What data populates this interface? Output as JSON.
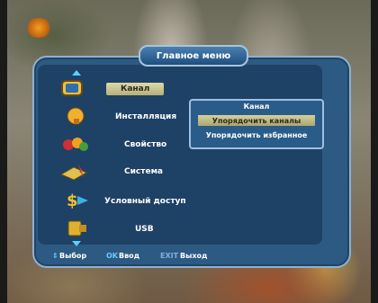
{
  "main_menu": {
    "title": "Главное меню",
    "items": [
      {
        "label": "Канал",
        "icon": "tv-icon",
        "selected": true
      },
      {
        "label": "Инсталляция",
        "icon": "satellite-dish-icon",
        "selected": false
      },
      {
        "label": "Свойство",
        "icon": "settings-cogs-icon",
        "selected": false
      },
      {
        "label": "Система",
        "icon": "receiver-icon",
        "selected": false
      },
      {
        "label": "Условный доступ",
        "icon": "dollar-icon",
        "selected": false
      },
      {
        "label": "USB",
        "icon": "usb-icon",
        "selected": false
      }
    ]
  },
  "submenu": {
    "title": "Канал",
    "items": [
      {
        "label": "Упорядочить каналы",
        "active": true
      },
      {
        "label": "Упорядочить избранное",
        "active": false
      }
    ]
  },
  "footer": {
    "select_key": "⇕",
    "select_label": "Выбор",
    "ok_key": "OK",
    "ok_label": "Ввод",
    "exit_key": "EXIT",
    "exit_label": "Выход"
  }
}
